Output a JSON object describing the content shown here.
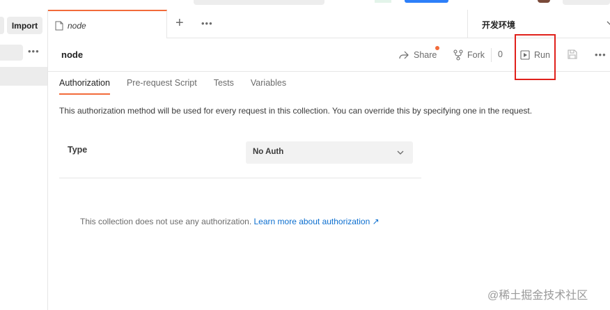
{
  "sidebar": {
    "import_label": "Import",
    "more_label": "•••"
  },
  "tabs": {
    "active_label": "node",
    "add_label": "+",
    "more_label": "•••"
  },
  "environment": {
    "label": "开发环境"
  },
  "header": {
    "collection_name": "node",
    "share_label": "Share",
    "fork_label": "Fork",
    "fork_count": "0",
    "run_label": "Run",
    "more_label": "•••"
  },
  "subtabs": [
    {
      "label": "Authorization",
      "active": true
    },
    {
      "label": "Pre-request Script",
      "active": false
    },
    {
      "label": "Tests",
      "active": false
    },
    {
      "label": "Variables",
      "active": false
    }
  ],
  "auth": {
    "description": "This authorization method will be used for every request in this collection. You can override this by specifying one in the request.",
    "type_label": "Type",
    "type_value": "No Auth",
    "info_text": "This collection does not use any authorization.",
    "info_link": "Learn more about authorization ↗"
  },
  "watermark": "@稀土掘金技术社区",
  "colors": {
    "accent": "#f26b3a",
    "link": "#0b6ecf",
    "highlight_box": "#e0201b"
  }
}
